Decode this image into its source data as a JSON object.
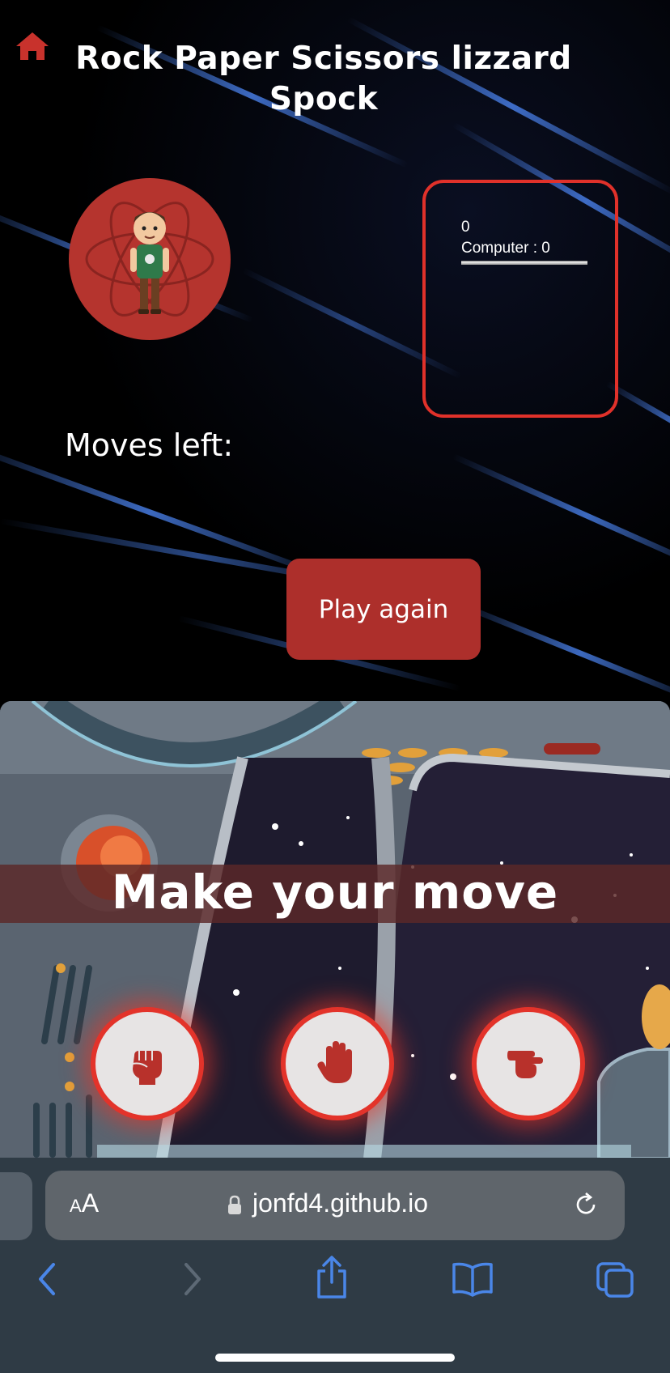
{
  "header": {
    "title": "Rock Paper Scissors lizzard Spock"
  },
  "scoreboard": {
    "player_score": "0",
    "computer_score": "Computer : 0"
  },
  "status": {
    "moves_left": "Moves left:"
  },
  "actions": {
    "play_again": "Play again"
  },
  "game": {
    "prompt": "Make your move",
    "moves": [
      {
        "name": "rock",
        "icon": "hand-rock-icon"
      },
      {
        "name": "paper",
        "icon": "hand-paper-icon"
      },
      {
        "name": "scissors",
        "icon": "hand-scissors-icon"
      }
    ]
  },
  "browser": {
    "text_size_small": "A",
    "text_size_large": "A",
    "url": "jonfd4.github.io"
  },
  "colors": {
    "accent_red": "#e3332a",
    "button_red": "#ad2f2b",
    "avatar_bg": "#b5342e",
    "ios_blue": "#4a86e8"
  }
}
